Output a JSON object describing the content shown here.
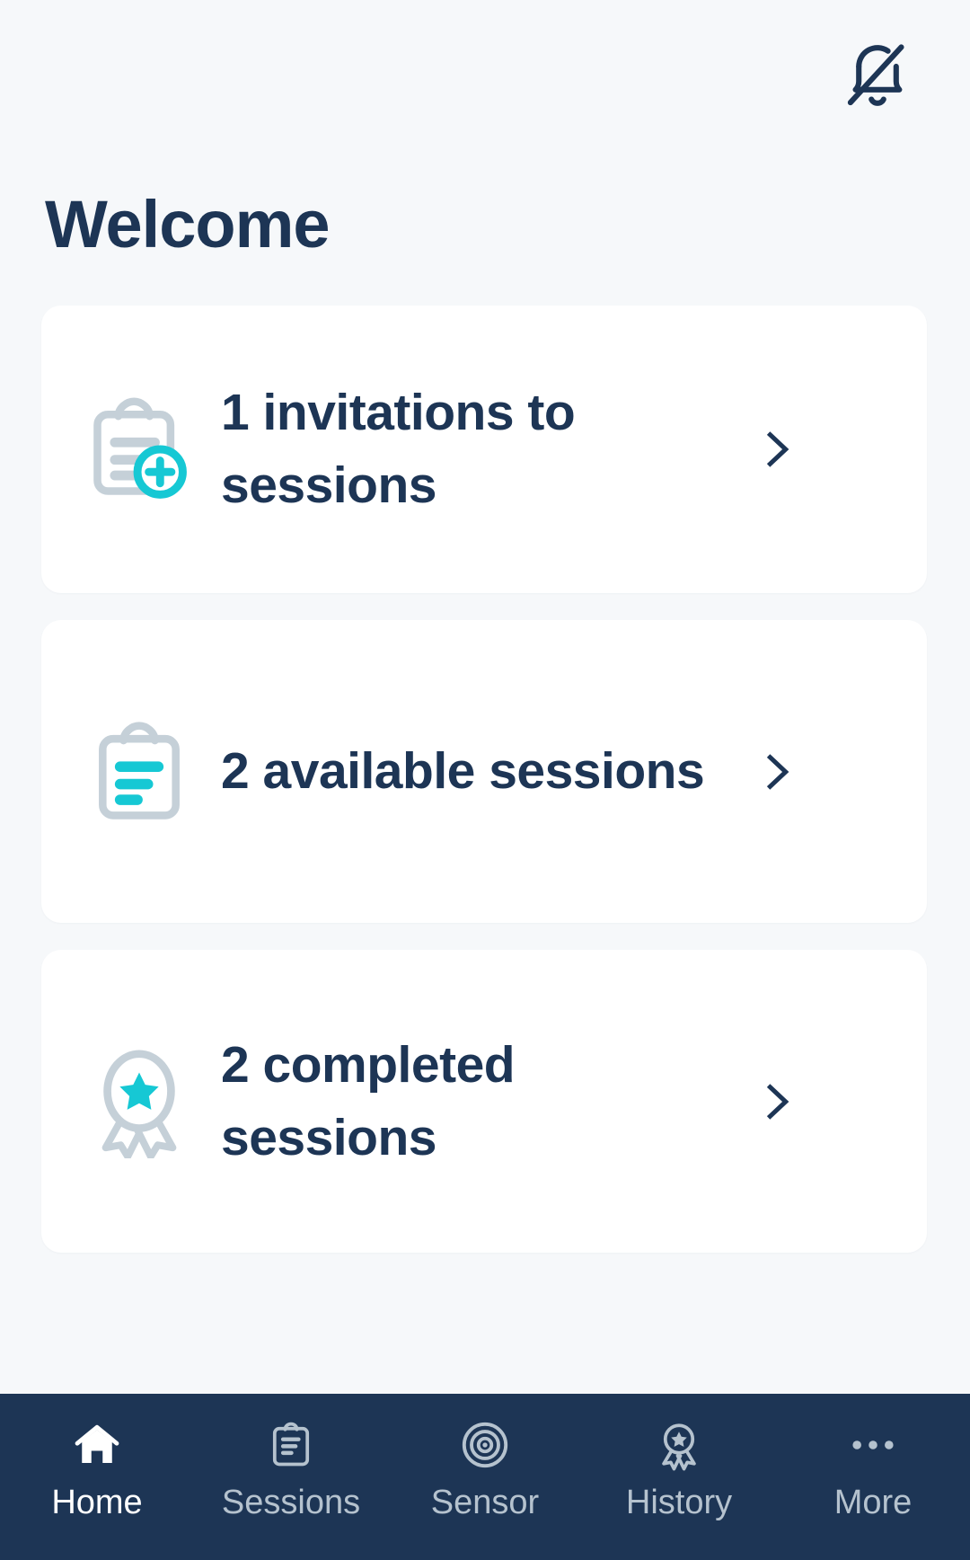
{
  "header": {
    "notification_icon": "bell-off-icon",
    "title": "Welcome"
  },
  "colors": {
    "background": "#f6f8fa",
    "card_background": "#ffffff",
    "navy": "#1d3555",
    "cyan": "#16c8d4",
    "icon_gray": "#c5d0d8",
    "tab_inactive": "#b5c2ce",
    "tab_active": "#ffffff"
  },
  "cards": [
    {
      "icon": "clipboard-plus-icon",
      "title": "1 invitations to sessions",
      "count": 1,
      "chevron": "chevron-right-icon"
    },
    {
      "icon": "clipboard-lines-icon",
      "title": "2 available sessions",
      "count": 2,
      "chevron": "chevron-right-icon"
    },
    {
      "icon": "award-ribbon-icon",
      "title": "2 completed sessions",
      "count": 2,
      "chevron": "chevron-right-icon"
    }
  ],
  "tabs": [
    {
      "label": "Home",
      "icon": "home-icon",
      "active": true
    },
    {
      "label": "Sessions",
      "icon": "clipboard-icon",
      "active": false
    },
    {
      "label": "Sensor",
      "icon": "target-icon",
      "active": false
    },
    {
      "label": "History",
      "icon": "award-icon",
      "active": false
    },
    {
      "label": "More",
      "icon": "ellipsis-icon",
      "active": false
    }
  ]
}
